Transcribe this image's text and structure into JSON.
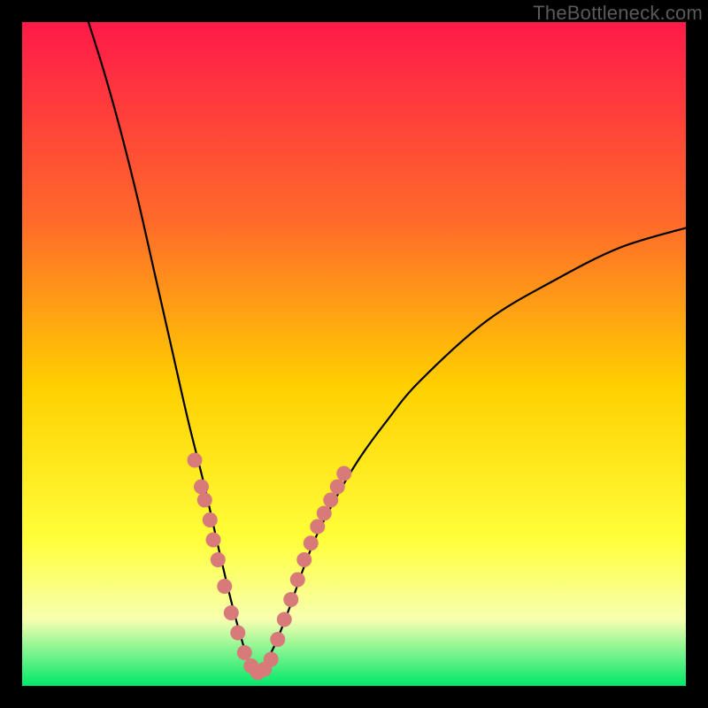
{
  "watermark": "TheBottleneck.com",
  "colors": {
    "black": "#000000",
    "curve": "#000000",
    "dot": "#d97a7a",
    "grad_top": "#ff1a49",
    "grad_mid1": "#ff6a2a",
    "grad_mid2": "#ffd000",
    "grad_mid3": "#ffff3a",
    "grad_mid4": "#f7ffb0",
    "grad_bot": "#00e86a"
  },
  "chart_data": {
    "type": "line",
    "title": "",
    "xlabel": "",
    "ylabel": "",
    "xlim": [
      0,
      100
    ],
    "ylim": [
      0,
      100
    ],
    "grid": false,
    "legend": false,
    "description": "V-shaped bottleneck curve plotted over a vertical red→orange→yellow→green gradient. Curve minimum sits in the green band near x≈35. Pink/salmon dots trace the lower part of the V on both sides of the minimum.",
    "left_branch": [
      {
        "x": 10.0,
        "y": 100.0
      },
      {
        "x": 12.5,
        "y": 92.0
      },
      {
        "x": 15.0,
        "y": 83.0
      },
      {
        "x": 17.5,
        "y": 73.0
      },
      {
        "x": 20.0,
        "y": 62.0
      },
      {
        "x": 22.5,
        "y": 51.0
      },
      {
        "x": 25.0,
        "y": 40.0
      },
      {
        "x": 27.5,
        "y": 30.0
      },
      {
        "x": 30.0,
        "y": 19.0
      },
      {
        "x": 32.5,
        "y": 9.0
      },
      {
        "x": 35.0,
        "y": 2.0
      }
    ],
    "right_branch": [
      {
        "x": 35.0,
        "y": 2.0
      },
      {
        "x": 37.5,
        "y": 5.0
      },
      {
        "x": 40.0,
        "y": 11.0
      },
      {
        "x": 42.5,
        "y": 18.0
      },
      {
        "x": 45.0,
        "y": 24.0
      },
      {
        "x": 50.0,
        "y": 33.0
      },
      {
        "x": 55.0,
        "y": 40.0
      },
      {
        "x": 60.0,
        "y": 46.0
      },
      {
        "x": 70.0,
        "y": 55.0
      },
      {
        "x": 80.0,
        "y": 61.0
      },
      {
        "x": 90.0,
        "y": 66.0
      },
      {
        "x": 100.0,
        "y": 69.0
      }
    ],
    "dots": [
      {
        "x": 26.0,
        "y": 34.0
      },
      {
        "x": 27.0,
        "y": 30.0
      },
      {
        "x": 27.5,
        "y": 28.0
      },
      {
        "x": 28.3,
        "y": 25.0
      },
      {
        "x": 28.8,
        "y": 22.0
      },
      {
        "x": 29.5,
        "y": 19.0
      },
      {
        "x": 30.5,
        "y": 15.0
      },
      {
        "x": 31.5,
        "y": 11.0
      },
      {
        "x": 32.5,
        "y": 8.0
      },
      {
        "x": 33.5,
        "y": 5.0
      },
      {
        "x": 34.5,
        "y": 3.0
      },
      {
        "x": 35.5,
        "y": 2.0
      },
      {
        "x": 36.5,
        "y": 2.5
      },
      {
        "x": 37.5,
        "y": 4.0
      },
      {
        "x": 38.5,
        "y": 7.0
      },
      {
        "x": 39.5,
        "y": 10.0
      },
      {
        "x": 40.5,
        "y": 13.0
      },
      {
        "x": 41.5,
        "y": 16.0
      },
      {
        "x": 42.5,
        "y": 19.0
      },
      {
        "x": 43.5,
        "y": 21.5
      },
      {
        "x": 44.5,
        "y": 24.0
      },
      {
        "x": 45.5,
        "y": 26.0
      },
      {
        "x": 46.5,
        "y": 28.0
      },
      {
        "x": 47.5,
        "y": 30.0
      },
      {
        "x": 48.5,
        "y": 32.0
      }
    ],
    "gradient_stops": [
      {
        "pos": 0.0,
        "key": "grad_top"
      },
      {
        "pos": 0.3,
        "key": "grad_mid1"
      },
      {
        "pos": 0.55,
        "key": "grad_mid2"
      },
      {
        "pos": 0.78,
        "key": "grad_mid3"
      },
      {
        "pos": 0.9,
        "key": "grad_mid4"
      },
      {
        "pos": 1.0,
        "key": "grad_bot"
      }
    ]
  }
}
